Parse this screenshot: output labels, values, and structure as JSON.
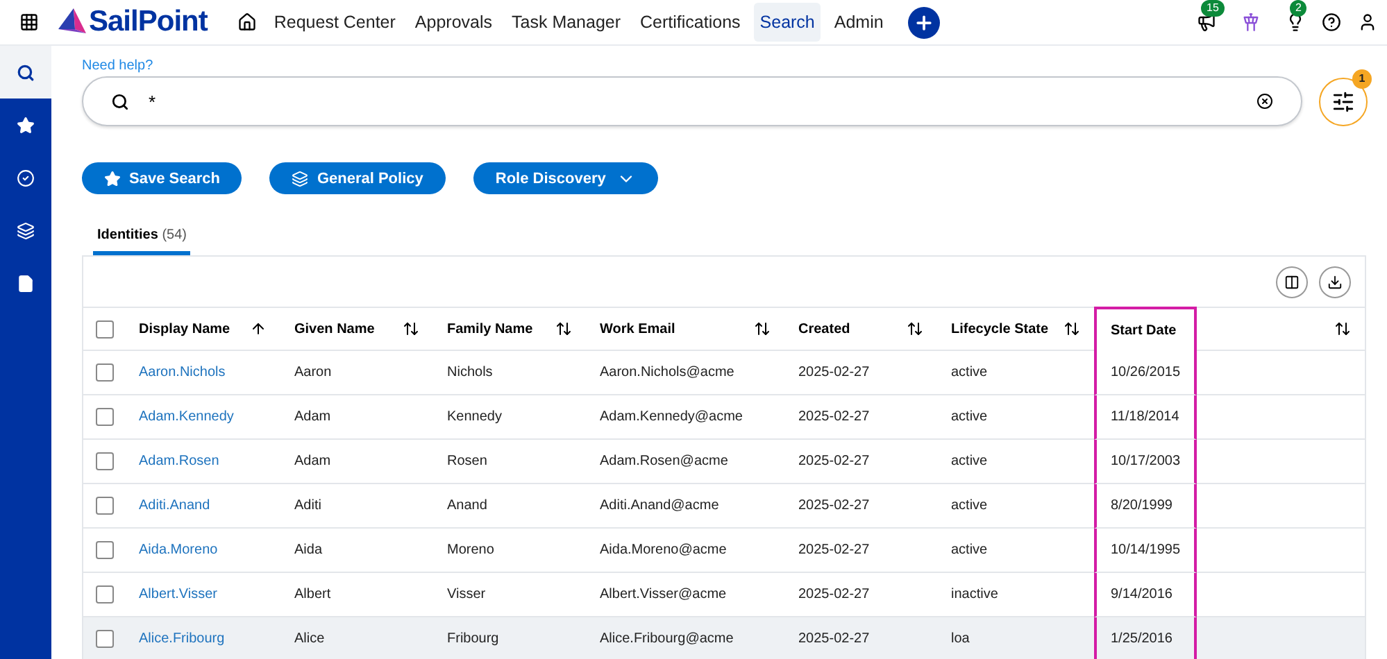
{
  "nav": {
    "brand": "SailPoint",
    "items": [
      {
        "label": "Request Center",
        "selected": false
      },
      {
        "label": "Approvals",
        "selected": false
      },
      {
        "label": "Task Manager",
        "selected": false
      },
      {
        "label": "Certifications",
        "selected": false
      },
      {
        "label": "Search",
        "selected": true
      },
      {
        "label": "Admin",
        "selected": false
      }
    ],
    "badges": {
      "notifications": "15",
      "tasks": "2"
    }
  },
  "sidebar": {
    "items": [
      {
        "kind": "search",
        "selected": true
      },
      {
        "kind": "star",
        "selected": false
      },
      {
        "kind": "check",
        "selected": false
      },
      {
        "kind": "layers",
        "selected": false
      },
      {
        "kind": "document",
        "selected": false
      }
    ]
  },
  "help_link": "Need help?",
  "search": {
    "value": "*"
  },
  "filter_count": "1",
  "actions": [
    {
      "kind": "star",
      "label": "Save Search"
    },
    {
      "kind": "layers",
      "label": "General Policy"
    },
    {
      "kind": "dropdown",
      "label": "Role Discovery"
    }
  ],
  "tabs": [
    {
      "label": "Identities",
      "count": "(54)",
      "selected": true
    }
  ],
  "table": {
    "select_all": {
      "checked": false
    },
    "columns": [
      {
        "label": "Display Name",
        "sorted": true,
        "highlighted": false
      },
      {
        "label": "Given Name",
        "sorted": false,
        "highlighted": false
      },
      {
        "label": "Family Name",
        "sorted": false,
        "highlighted": false
      },
      {
        "label": "Work Email",
        "sorted": false,
        "highlighted": false
      },
      {
        "label": "Created",
        "sorted": false,
        "highlighted": false
      },
      {
        "label": "Lifecycle State",
        "sorted": false,
        "highlighted": false
      },
      {
        "label": "Start Date",
        "highlighted": true
      },
      {
        "sorted": false,
        "highlighted": false
      }
    ],
    "rows": [
      {
        "cells": [
          "Aaron.Nichols",
          "Aaron",
          "Nichols",
          "Aaron.Nichols@acme",
          "2025-02-27",
          "active",
          "10/26/2015"
        ],
        "checked": false,
        "hovered": false
      },
      {
        "cells": [
          "Adam.Kennedy",
          "Adam",
          "Kennedy",
          "Adam.Kennedy@acme",
          "2025-02-27",
          "active",
          "11/18/2014"
        ],
        "checked": false,
        "hovered": false
      },
      {
        "cells": [
          "Adam.Rosen",
          "Adam",
          "Rosen",
          "Adam.Rosen@acme",
          "2025-02-27",
          "active",
          "10/17/2003"
        ],
        "checked": false,
        "hovered": false
      },
      {
        "cells": [
          "Aditi.Anand",
          "Aditi",
          "Anand",
          "Aditi.Anand@acme",
          "2025-02-27",
          "active",
          "8/20/1999"
        ],
        "checked": false,
        "hovered": false
      },
      {
        "cells": [
          "Aida.Moreno",
          "Aida",
          "Moreno",
          "Aida.Moreno@acme",
          "2025-02-27",
          "active",
          "10/14/1995"
        ],
        "checked": false,
        "hovered": false
      },
      {
        "cells": [
          "Albert.Visser",
          "Albert",
          "Visser",
          "Albert.Visser@acme",
          "2025-02-27",
          "inactive",
          "9/14/2016"
        ],
        "checked": false,
        "hovered": false
      },
      {
        "cells": [
          "Alice.Fribourg",
          "Alice",
          "Fribourg",
          "Alice.Fribourg@acme",
          "2025-02-27",
          "loa",
          "1/25/2016"
        ],
        "checked": false,
        "hovered": true
      }
    ]
  }
}
